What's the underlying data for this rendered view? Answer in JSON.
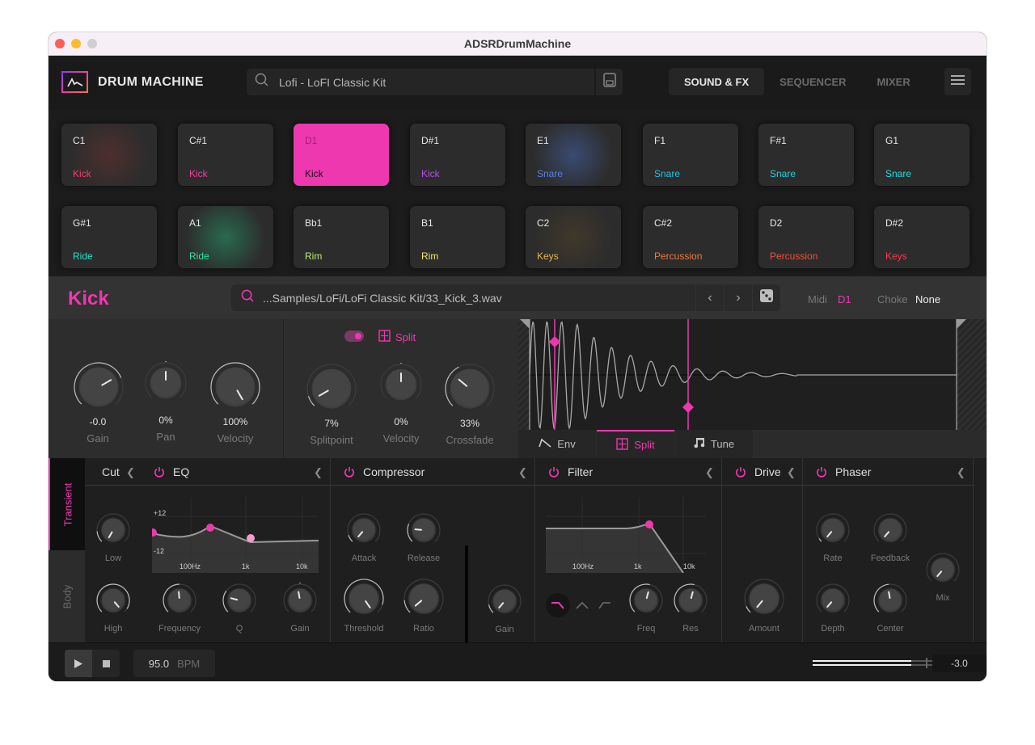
{
  "window": {
    "title": "ADSRDrumMachine"
  },
  "header": {
    "logo_text": "DRUM MACHINE",
    "preset_name": "Lofi - LoFI Classic Kit",
    "tabs": [
      {
        "label": "SOUND & FX",
        "active": true
      },
      {
        "label": "SEQUENCER",
        "active": false
      },
      {
        "label": "MIXER",
        "active": false
      }
    ]
  },
  "pads": [
    {
      "note": "C1",
      "name": "Kick",
      "color": "#ef3f6a",
      "glow": "rgba(120,50,50,0.45)"
    },
    {
      "note": "C#1",
      "name": "Kick",
      "color": "#ef3fa0",
      "glow": ""
    },
    {
      "note": "D1",
      "name": "Kick",
      "color": "#2a0a1c",
      "active": true
    },
    {
      "note": "D#1",
      "name": "Kick",
      "color": "#b450e0",
      "glow": ""
    },
    {
      "note": "E1",
      "name": "Snare",
      "color": "#5a7ee0",
      "glow": "rgba(70,100,170,0.55)"
    },
    {
      "note": "F1",
      "name": "Snare",
      "color": "#1ec3e6",
      "glow": ""
    },
    {
      "note": "F#1",
      "name": "Snare",
      "color": "#1ed2e6",
      "glow": ""
    },
    {
      "note": "G1",
      "name": "Snare",
      "color": "#1ee0e0",
      "glow": ""
    },
    {
      "note": "G#1",
      "name": "Ride",
      "color": "#1ee6c8",
      "glow": ""
    },
    {
      "note": "A1",
      "name": "Ride",
      "color": "#2ee6a0",
      "glow": "rgba(40,140,100,0.65)"
    },
    {
      "note": "Bb1",
      "name": "Rim",
      "color": "#b4f078",
      "glow": ""
    },
    {
      "note": "B1",
      "name": "Rim",
      "color": "#f0e664",
      "glow": ""
    },
    {
      "note": "C2",
      "name": "Keys",
      "color": "#e6b450",
      "glow": "rgba(100,80,40,0.35)"
    },
    {
      "note": "C#2",
      "name": "Percussion",
      "color": "#f0783c",
      "glow": ""
    },
    {
      "note": "D2",
      "name": "Percussion",
      "color": "#f0503c",
      "glow": ""
    },
    {
      "note": "D#2",
      "name": "Keys",
      "color": "#f03c50",
      "glow": ""
    }
  ],
  "instrument": {
    "title": "Kick",
    "sample_path": "...Samples/LoFi/LoFi Classic Kit/33_Kick_3.wav",
    "midi_label": "Midi",
    "midi_value": "D1",
    "choke_label": "Choke",
    "choke_value": "None"
  },
  "main_knobs": [
    {
      "value": "-0.0",
      "label": "Gain",
      "angle": 60
    },
    {
      "value": "0%",
      "label": "Pan",
      "angle": 0
    },
    {
      "value": "100%",
      "label": "Velocity",
      "angle": 150
    }
  ],
  "split": {
    "enabled": true,
    "label": "Split",
    "knobs": [
      {
        "value": "7%",
        "label": "Splitpoint",
        "angle": -120
      },
      {
        "value": "0%",
        "label": "Velocity",
        "angle": 0
      },
      {
        "value": "33%",
        "label": "Crossfade",
        "angle": -50
      }
    ]
  },
  "wave_tabs": [
    {
      "label": "Env",
      "active": false
    },
    {
      "label": "Split",
      "active": true
    },
    {
      "label": "Tune",
      "active": false
    }
  ],
  "fx": {
    "side_tabs": [
      {
        "label": "Transient",
        "active": true
      },
      {
        "label": "Body",
        "active": false
      }
    ],
    "cut": {
      "title": "Cut",
      "knobs": [
        {
          "label": "Low"
        },
        {
          "label": "High"
        }
      ]
    },
    "eq": {
      "title": "EQ",
      "y_labels": [
        "+12",
        "-12"
      ],
      "x_labels": [
        "100Hz",
        "1k",
        "10k"
      ],
      "knobs": [
        {
          "label": "Frequency"
        },
        {
          "label": "Q"
        },
        {
          "label": "Gain"
        }
      ]
    },
    "compressor": {
      "title": "Compressor",
      "knobs": [
        {
          "label": "Attack"
        },
        {
          "label": "Release"
        },
        {
          "label": "Threshold"
        },
        {
          "label": "Ratio"
        },
        {
          "label": "Gain"
        }
      ]
    },
    "filter": {
      "title": "Filter",
      "x_labels": [
        "100Hz",
        "1k",
        "10k"
      ],
      "types": [
        "lowpass",
        "bandpass",
        "highpass"
      ],
      "selected_type": "lowpass",
      "knobs": [
        {
          "label": "Freq"
        },
        {
          "label": "Res"
        }
      ]
    },
    "drive": {
      "title": "Drive",
      "knobs": [
        {
          "label": "Amount"
        }
      ]
    },
    "phaser": {
      "title": "Phaser",
      "knobs": [
        {
          "label": "Rate"
        },
        {
          "label": "Feedback"
        },
        {
          "label": "Mix"
        },
        {
          "label": "Depth"
        },
        {
          "label": "Center"
        }
      ]
    }
  },
  "transport": {
    "bpm_value": "95.0",
    "bpm_unit": "BPM",
    "output_level": "-3.0"
  },
  "colors": {
    "accent": "#ee38b0",
    "background": "#1b1b1b"
  }
}
